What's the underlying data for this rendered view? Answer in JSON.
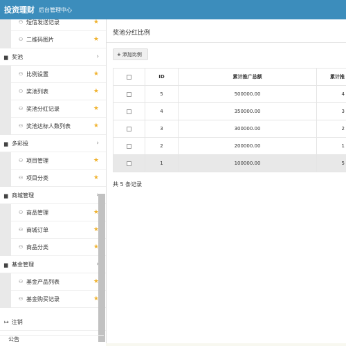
{
  "header": {
    "brand": "投资理财",
    "subtitle": "后台管理中心"
  },
  "sidebar": {
    "items": [
      {
        "type": "child",
        "label": "短信发送记录"
      },
      {
        "type": "child",
        "label": "二维码图片"
      },
      {
        "type": "parent",
        "label": "奖池"
      },
      {
        "type": "child",
        "label": "比例设置"
      },
      {
        "type": "child",
        "label": "奖池列表"
      },
      {
        "type": "child",
        "label": "奖池分红记录"
      },
      {
        "type": "child",
        "label": "奖池达标人数列表"
      },
      {
        "type": "parent",
        "label": "多彩投"
      },
      {
        "type": "child",
        "label": "项目管理"
      },
      {
        "type": "child",
        "label": "项目分类"
      },
      {
        "type": "parent",
        "label": "商城管理"
      },
      {
        "type": "child",
        "label": "商品管理"
      },
      {
        "type": "child",
        "label": "商城订单"
      },
      {
        "type": "child",
        "label": "商品分类"
      },
      {
        "type": "parent",
        "label": "基金管理"
      },
      {
        "type": "child",
        "label": "基金产品列表"
      },
      {
        "type": "child",
        "label": "基金购买记录"
      }
    ],
    "logout_label": "注销",
    "bottom_partial": "公告"
  },
  "main": {
    "title": "奖池分红比例",
    "add_button": "添加比例",
    "table": {
      "headers": [
        "",
        "ID",
        "累计推广总额",
        "累计推"
      ],
      "rows": [
        {
          "id": "5",
          "total": "500000.00",
          "extra": "4"
        },
        {
          "id": "4",
          "total": "350000.00",
          "extra": "3"
        },
        {
          "id": "3",
          "total": "300000.00",
          "extra": "2"
        },
        {
          "id": "2",
          "total": "200000.00",
          "extra": "1"
        },
        {
          "id": "1",
          "total": "100000.00",
          "extra": "5"
        }
      ]
    },
    "record_count": "共 5 条记录"
  }
}
